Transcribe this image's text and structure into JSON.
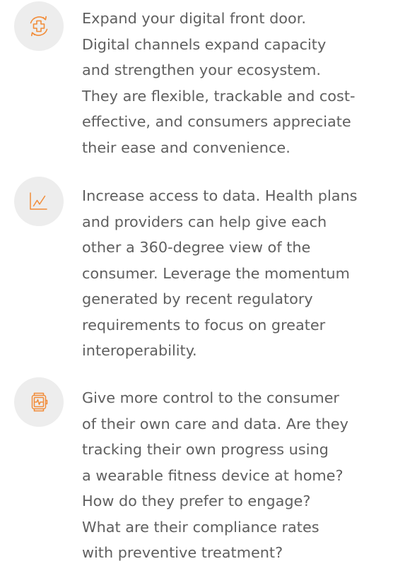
{
  "colors": {
    "accent": "#f28c38",
    "text": "#5f5f5f",
    "icon_background": "#ededed",
    "page_background": "#ffffff"
  },
  "items": [
    {
      "icon": "refresh-medical-cross-icon",
      "lines": [
        "Expand your digital front door.",
        "Digital channels expand capacity",
        "and strengthen your ecosystem.",
        "They are flexible, trackable and cost-",
        "effective, and consumers appreciate",
        "their ease and convenience."
      ]
    },
    {
      "icon": "line-chart-icon",
      "lines": [
        "Increase access to data. Health plans",
        "and providers can help give each",
        "other a 360-degree view of the",
        "consumer. Leverage the momentum",
        "generated by recent regulatory",
        "requirements to focus on greater",
        "interoperability."
      ]
    },
    {
      "icon": "smartwatch-heartbeat-icon",
      "lines": [
        "Give more control to the consumer",
        "of their own care and data. Are they",
        "tracking their own progress using",
        "a wearable fitness device at home?",
        "How do they prefer to engage?",
        "What are their compliance rates",
        "with preventive treatment?"
      ]
    }
  ]
}
